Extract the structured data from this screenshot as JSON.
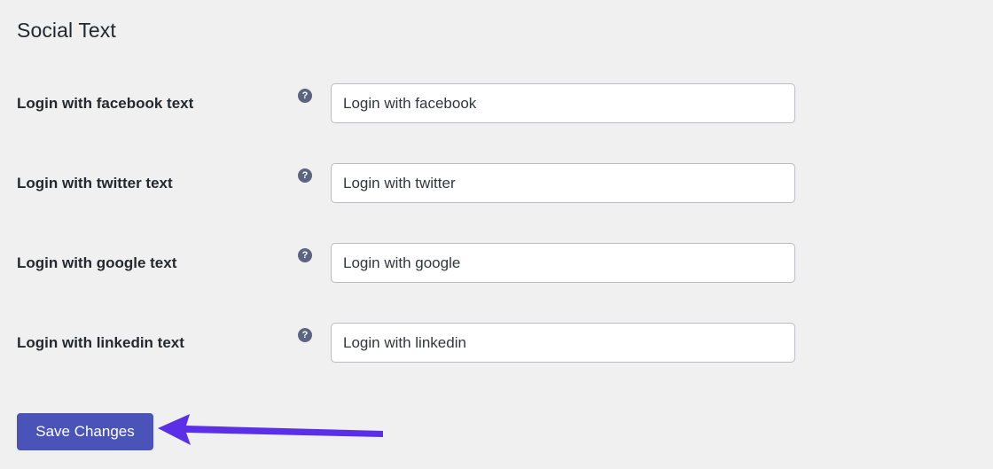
{
  "section": {
    "title": "Social Text"
  },
  "fields": [
    {
      "label": "Login with facebook text",
      "help_icon": "help-icon",
      "help_glyph": "?",
      "value": "Login with facebook",
      "placeholder": "Login with facebook"
    },
    {
      "label": "Login with twitter text",
      "help_icon": "help-icon",
      "help_glyph": "?",
      "value": "Login with twitter",
      "placeholder": "Login with twitter"
    },
    {
      "label": "Login with google text",
      "help_icon": "help-icon",
      "help_glyph": "?",
      "value": "Login with google",
      "placeholder": "Login with google"
    },
    {
      "label": "Login with linkedin text",
      "help_icon": "help-icon",
      "help_glyph": "?",
      "value": "Login with linkedin",
      "placeholder": "Login with linkedin"
    }
  ],
  "actions": {
    "save_label": "Save Changes"
  },
  "annotation": {
    "arrow_icon": "arrow-left-icon",
    "arrow_color": "#5b2fe8",
    "points_to": "Save Changes"
  },
  "colors": {
    "background": "#f0f0f1",
    "label_text": "#25292e",
    "title_text": "#23282d",
    "input_background": "#ffffff",
    "input_border": "#b9bcc0",
    "input_text": "#32373c",
    "help_icon_background": "#5b6480",
    "button_background": "#4953b8",
    "button_text": "#ffffff",
    "annotation_arrow": "#5b2fe8"
  }
}
